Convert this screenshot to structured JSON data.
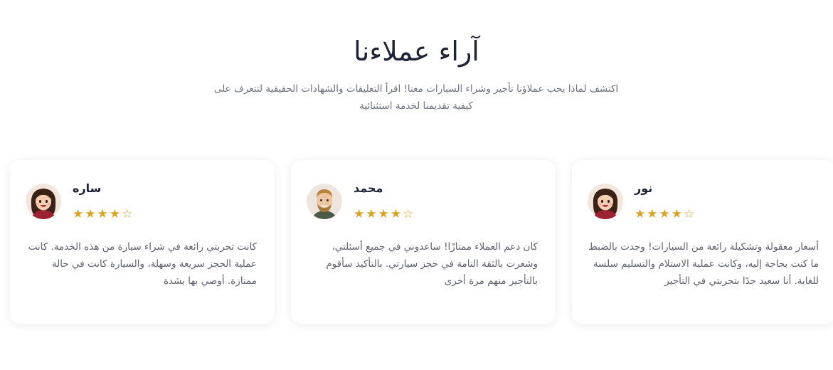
{
  "section": {
    "title": "آراء عملاءنا",
    "subtitle": "اكتشف لماذا يحب عملاؤنا تأجير وشراء السيارات معنا! اقرأ التعليقات والشهادات الحقيقية لتتعرف على كيفية تقديمنا لخدمة استثنائية"
  },
  "reviews": [
    {
      "name": "ساره",
      "avatar": "female-avatar",
      "rating": 4,
      "rating_max": 5,
      "text": "كانت تجربتي رائعة في شراء سيارة من هذه الخدمة. كانت عملية الحجز سريعة وسهلة، والسيارة كانت في حالة ممتازة. أوصي بها بشدة"
    },
    {
      "name": "محمد",
      "avatar": "male-avatar",
      "rating": 4,
      "rating_max": 5,
      "text": "كان دعم العملاء ممتازًا! ساعدوني في جميع أسئلتي، وشعرت بالثقة التامة في حجز سيارتي. بالتأكيد سأقوم بالتأجير منهم مرة أخرى"
    },
    {
      "name": "نور",
      "avatar": "female-avatar",
      "rating": 4,
      "rating_max": 5,
      "text": "أسعار معقولة وتشكيلة رائعة من السيارات! وجدت بالضبط ما كنت بحاجة إليه، وكانت عملية الاستلام والتسليم سلسة للغاية. أنا سعيد جدًا بتجربتي في التأجير"
    }
  ],
  "colors": {
    "star": "#d9a321",
    "title": "#1e2235",
    "text": "#5f6270"
  },
  "icons": {
    "star_filled": "star-filled-icon",
    "star_empty": "star-empty-icon"
  }
}
